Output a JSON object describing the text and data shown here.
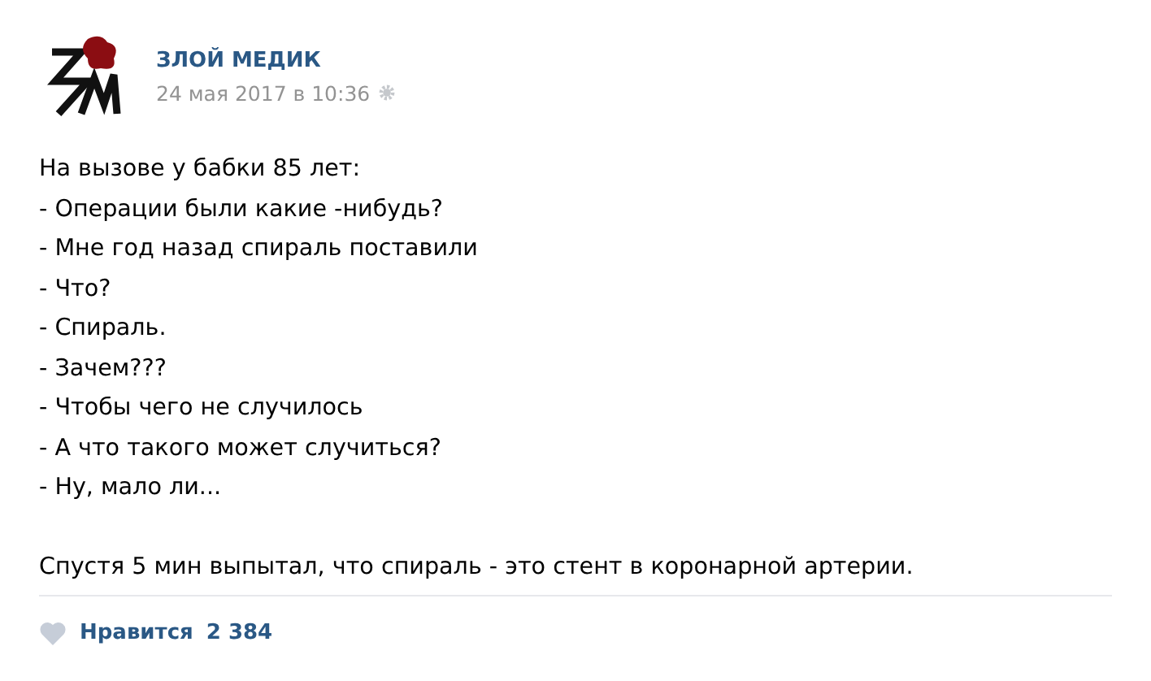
{
  "post": {
    "author": "ЗЛОЙ МЕДИК",
    "date": "24 мая 2017 в 10:36",
    "lines": [
      "На вызове у бабки 85 лет:",
      "- Операции были какие -нибудь?",
      "- Мне год назад спираль поставили",
      "- Что?",
      "- Спираль.",
      "- Зачем???",
      "- Чтобы чего не случилось",
      "- А что такого может случиться?",
      "- Ну, мало ли..."
    ],
    "conclusion": "Спустя 5 мин выпытал, что спираль - это стент в коронарной артерии."
  },
  "likes": {
    "label": "Нравится",
    "count": "2 384",
    "liked": false
  }
}
